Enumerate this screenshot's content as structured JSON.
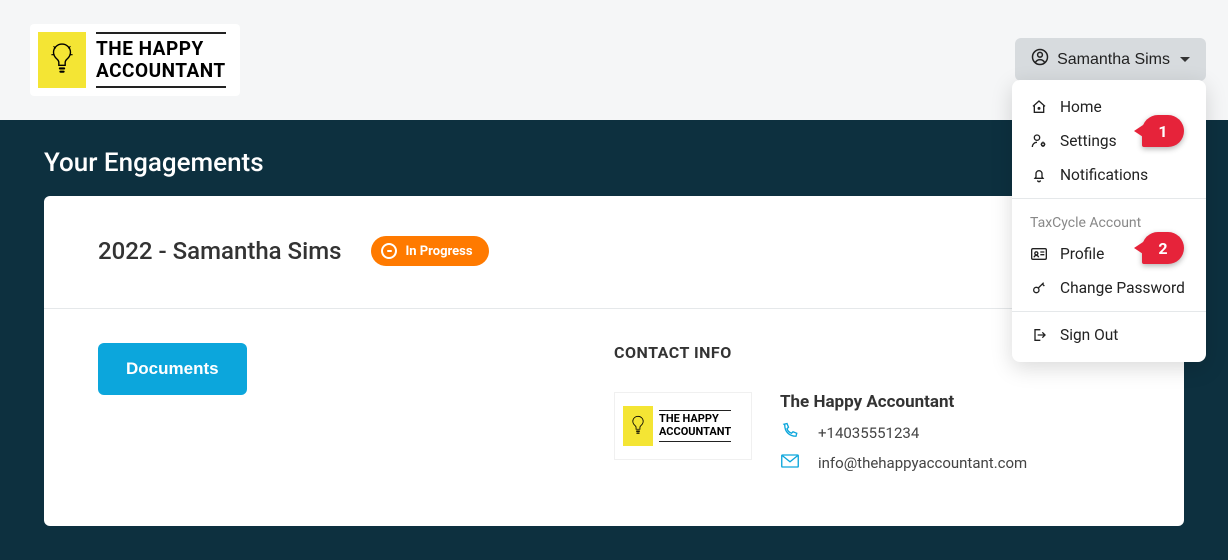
{
  "brand": {
    "line1": "THE HAPPY",
    "line2": "ACCOUNTANT"
  },
  "user": {
    "name": "Samantha Sims"
  },
  "page": {
    "title": "Your Engagements"
  },
  "engagement": {
    "title": "2022 - Samantha Sims",
    "status": "In Progress",
    "documents_btn": "Documents"
  },
  "contact": {
    "heading": "CONTACT INFO",
    "name": "The Happy Accountant",
    "phone": "+14035551234",
    "email": "info@thehappyaccountant.com"
  },
  "menu": {
    "home": "Home",
    "settings": "Settings",
    "notifications": "Notifications",
    "section": "TaxCycle Account",
    "profile": "Profile",
    "change_password": "Change Password",
    "sign_out": "Sign Out"
  },
  "annotations": {
    "a1": "1",
    "a2": "2"
  }
}
